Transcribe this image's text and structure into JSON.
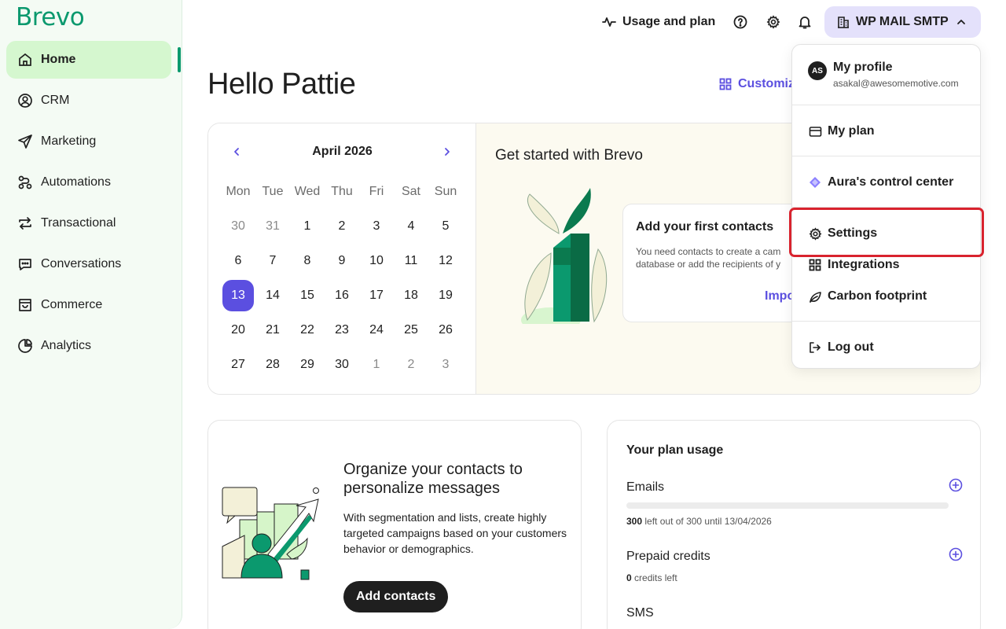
{
  "sidebar": {
    "logo": "Brevo",
    "items": [
      {
        "label": "Home",
        "icon": "home-icon"
      },
      {
        "label": "CRM",
        "icon": "contacts-icon"
      },
      {
        "label": "Marketing",
        "icon": "send-icon"
      },
      {
        "label": "Automations",
        "icon": "workflow-icon"
      },
      {
        "label": "Transactional",
        "icon": "arrows-icon"
      },
      {
        "label": "Conversations",
        "icon": "chat-icon"
      },
      {
        "label": "Commerce",
        "icon": "shopping-bag-icon"
      },
      {
        "label": "Analytics",
        "icon": "pie-chart-icon"
      }
    ],
    "active_item": "Home"
  },
  "header": {
    "usage_label": "Usage and plan",
    "account_label": "WP MAIL SMTP"
  },
  "main": {
    "greeting": "Hello Pattie",
    "customize_label": "Customiz"
  },
  "calendar": {
    "title": "April 2026",
    "weekdays": [
      "Mon",
      "Tue",
      "Wed",
      "Thu",
      "Fri",
      "Sat",
      "Sun"
    ],
    "days": [
      "30",
      "31",
      "1",
      "2",
      "3",
      "4",
      "5",
      "6",
      "7",
      "8",
      "9",
      "10",
      "11",
      "12",
      "13",
      "14",
      "15",
      "16",
      "17",
      "18",
      "19",
      "20",
      "21",
      "22",
      "23",
      "24",
      "25",
      "26",
      "27",
      "28",
      "29",
      "30",
      "1",
      "2",
      "3"
    ],
    "muted_before": 2,
    "muted_after": 3,
    "today": "13"
  },
  "get_started": {
    "title": "Get started with Brevo",
    "card_title": "Add your first contacts",
    "card_desc_line1": "You need contacts to create a cam",
    "card_desc_line2": "database or add the recipients of y",
    "card_link": "Impo"
  },
  "organize": {
    "title": "Organize your contacts to personalize messages",
    "description": "With segmentation and lists, create highly targeted campaigns based on your customers behavior or demographics.",
    "button": "Add contacts"
  },
  "plan_usage": {
    "title": "Your plan usage",
    "emails_label": "Emails",
    "emails_left": "300",
    "emails_note": "left out of 300 until 13/04/2026",
    "emails_used_fraction": 0,
    "prepaid_label": "Prepaid credits",
    "prepaid_left": "0",
    "prepaid_note": "credits left",
    "sms_label": "SMS"
  },
  "account_menu": {
    "avatar_initials": "AS",
    "profile_name": "My profile",
    "profile_email": "asakal@awesomemotive.com",
    "my_plan": "My plan",
    "aura": "Aura's control center",
    "settings": "Settings",
    "integrations": "Integrations",
    "carbon": "Carbon footprint",
    "logout": "Log out",
    "highlighted_item": "Settings"
  },
  "colors": {
    "brand_green": "#0b996e",
    "accent_purple": "#5b4fe0",
    "highlight_red": "#d9232e",
    "sidebar_active": "#d5f7cf"
  }
}
